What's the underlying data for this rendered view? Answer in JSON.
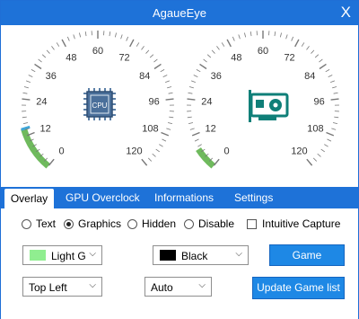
{
  "window": {
    "title": "AgaueEye",
    "close_glyph": "X"
  },
  "gauges": {
    "cpu": {
      "ticks": [
        "0",
        "12",
        "24",
        "36",
        "48",
        "60",
        "72",
        "84",
        "96",
        "108",
        "120"
      ],
      "icon_label": "CPU",
      "icon": "cpu-chip-icon",
      "level_fraction": 0.12,
      "arc_color": "#6fba5d",
      "needle_color": "#3ea6d8"
    },
    "gpu": {
      "ticks": [
        "0",
        "12",
        "24",
        "36",
        "48",
        "60",
        "72",
        "84",
        "96",
        "108",
        "120"
      ],
      "icon": "gpu-card-icon",
      "level_fraction": 0.06,
      "arc_color": "#6fba5d",
      "icon_color": "#0f7f78"
    }
  },
  "tabs": [
    {
      "label": "Overlay",
      "active": true
    },
    {
      "label": "GPU Overclock",
      "active": false
    },
    {
      "label": "Informations",
      "active": false
    },
    {
      "label": "Settings",
      "active": false
    }
  ],
  "overlay": {
    "modes": [
      {
        "label": "Text",
        "selected": false
      },
      {
        "label": "Graphics",
        "selected": true
      },
      {
        "label": "Hidden",
        "selected": false
      },
      {
        "label": "Disable",
        "selected": false
      }
    ],
    "intuitive_capture": {
      "label": "Intuitive Capture",
      "checked": false
    },
    "text_color": {
      "value": "Light G",
      "swatch": "#90ee90"
    },
    "background_color": {
      "value": "Black",
      "swatch": "#000000"
    },
    "position": {
      "value": "Top Left"
    },
    "size": {
      "value": "Auto"
    },
    "game_sessions_button": "Game Sessions",
    "update_game_list_button": "Update Game list"
  },
  "accent_color": "#1e72d8"
}
